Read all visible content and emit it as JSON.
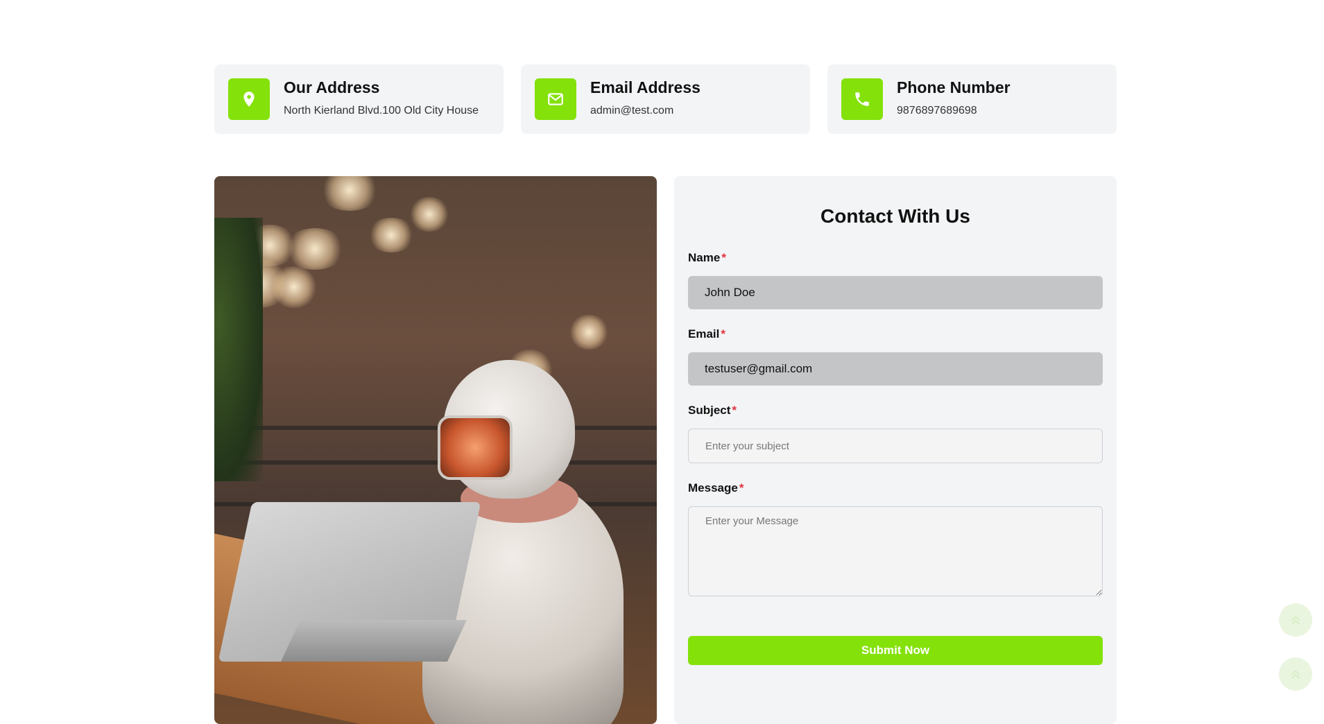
{
  "info_cards": [
    {
      "title": "Our Address",
      "value": "North Kierland Blvd.100 Old City House",
      "icon": "map-pin-icon"
    },
    {
      "title": "Email Address",
      "value": "admin@test.com",
      "icon": "envelope-icon"
    },
    {
      "title": "Phone Number",
      "value": "9876897689698",
      "icon": "phone-icon"
    }
  ],
  "image": {
    "icon": "robot-at-laptop-photo"
  },
  "form": {
    "title": "Contact With Us",
    "required_mark": "*",
    "name": {
      "label": "Name",
      "value": "John Doe"
    },
    "email": {
      "label": "Email",
      "value": "testuser@gmail.com"
    },
    "subject": {
      "label": "Subject",
      "placeholder": "Enter your subject"
    },
    "message": {
      "label": "Message",
      "placeholder": "Enter your Message"
    },
    "submit_label": "Submit Now"
  },
  "colors": {
    "accent": "#84e10a",
    "card_bg": "#f3f4f6",
    "required": "#e0313d",
    "filled_field_bg": "#c4c5c7"
  },
  "scroll_buttons": [
    {
      "icon": "double-chevron-up-icon"
    },
    {
      "icon": "double-chevron-up-icon"
    }
  ]
}
